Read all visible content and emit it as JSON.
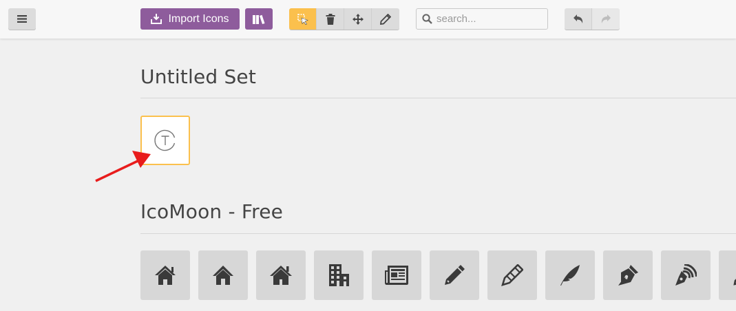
{
  "toolbar": {
    "menu_icon": "hamburger-icon",
    "import_label": "Import Icons",
    "import_icon": "import-icon",
    "library_icon": "library-icon",
    "tools": [
      "select-icon",
      "trash-icon",
      "move-icon",
      "pencil-icon"
    ],
    "search_placeholder": "search...",
    "undo_icon": "undo-icon",
    "redo_icon": "redo-icon"
  },
  "sets": [
    {
      "title": "Untitled Set",
      "icons": [
        "glyph-t-circle-icon"
      ]
    },
    {
      "title": "IcoMoon - Free",
      "icons": [
        "home-icon",
        "home2-icon",
        "home3-icon",
        "office-icon",
        "newspaper-icon",
        "pencil-icon",
        "pencil2-icon",
        "quill-icon",
        "pen-icon",
        "blog-icon",
        "eyedropper-icon"
      ]
    }
  ],
  "colors": {
    "accent": "#fbc04d",
    "purple": "#8e5c9c",
    "tile": "#d7d7d7",
    "annotation_arrow": "#e81c1c"
  }
}
